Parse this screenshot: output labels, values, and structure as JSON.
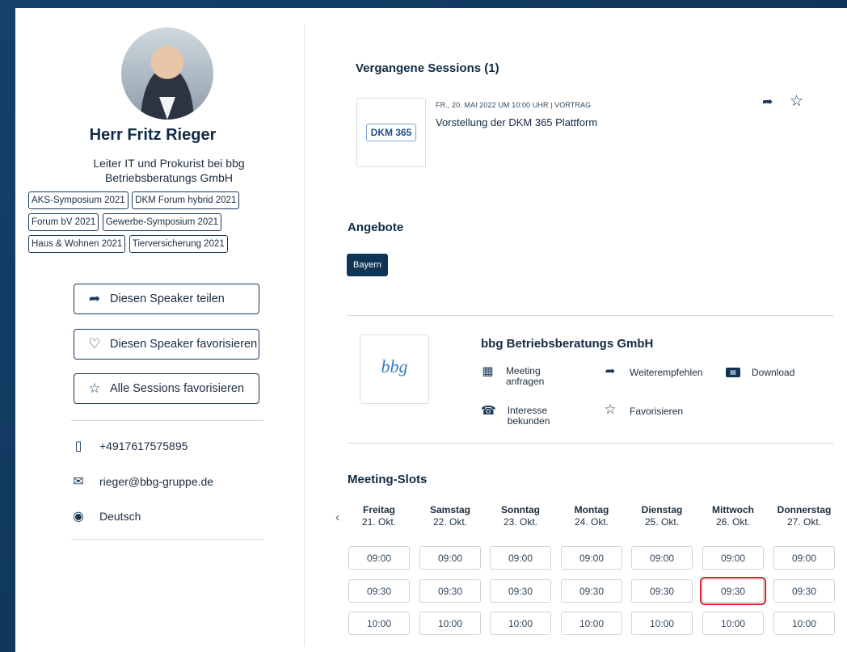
{
  "speaker": {
    "name": "Herr Fritz Rieger",
    "role": "Leiter IT und Prokurist bei bbg Betriebsberatungs GmbH",
    "tags": [
      "AKS-Symposium 2021",
      "DKM Forum hybrid 2021",
      "Forum bV 2021",
      "Gewerbe-Symposium 2021",
      "Haus & Wohnen 2021",
      "Tierversicherung 2021"
    ],
    "share_label": "Diesen Speaker teilen",
    "favorite_label": "Diesen Speaker favorisieren",
    "fav_sessions_label": "Alle Sessions favorisieren",
    "phone": "+4917617575895",
    "email": "rieger@bbg-gruppe.de",
    "language": "Deutsch"
  },
  "sessions": {
    "heading": "Vergangene Sessions (1)",
    "items": [
      {
        "logo_text": "DKM 365",
        "meta": "FR., 20. MAI 2022 UM 10:00 UHR | VORTRAG",
        "title": "Vorstellung der DKM 365 Plattform"
      }
    ]
  },
  "offers": {
    "heading": "Angebote",
    "badge": "Bayern"
  },
  "company": {
    "logo_text": "bbg",
    "name": "bbg Betriebsberatungs GmbH",
    "actions": {
      "meeting": "Meeting anfragen",
      "recommend": "Weiterempfehlen",
      "download": "Download",
      "interest": "Interesse bekunden",
      "favorite": "Favorisieren"
    }
  },
  "slots": {
    "heading": "Meeting-Slots",
    "days": [
      {
        "name": "Freitag",
        "date": "21. Okt."
      },
      {
        "name": "Samstag",
        "date": "22. Okt."
      },
      {
        "name": "Sonntag",
        "date": "23. Okt."
      },
      {
        "name": "Montag",
        "date": "24. Okt."
      },
      {
        "name": "Dienstag",
        "date": "25. Okt."
      },
      {
        "name": "Mittwoch",
        "date": "26. Okt."
      },
      {
        "name": "Donnerstag",
        "date": "27. Okt."
      }
    ],
    "times": [
      "09:00",
      "09:30",
      "10:00"
    ],
    "highlighted": {
      "day": "Mittwoch",
      "time": "09:30"
    }
  },
  "icons": {
    "share": "share-arrow-icon",
    "heart": "heart-icon",
    "star": "star-icon",
    "phone": "phone-icon",
    "mail": "mail-icon",
    "language": "language-bubble-icon",
    "calendar": "calendar-icon",
    "download": "card-icon",
    "interest": "handshake-icon",
    "chevron": "chevron-left-icon"
  },
  "colors": {
    "accent": "#0f3556",
    "highlight": "#d8232a"
  }
}
